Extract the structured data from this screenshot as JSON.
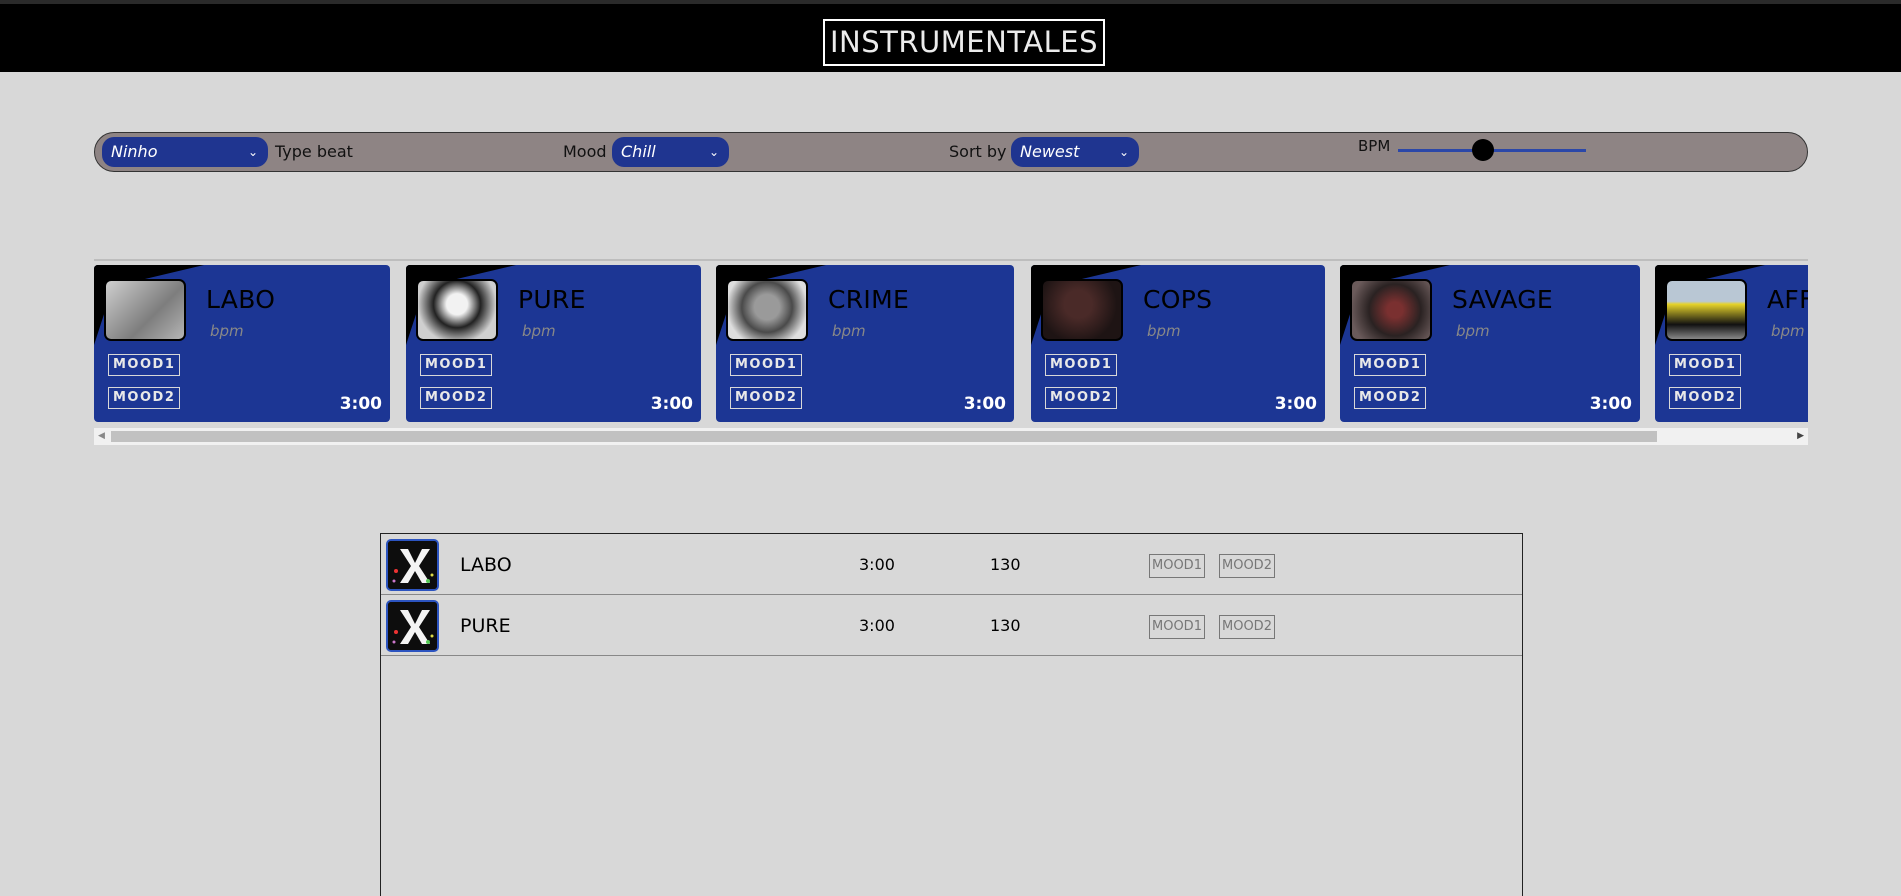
{
  "header": {
    "title": "INSTRUMENTALES"
  },
  "filters": {
    "artist": "Ninho",
    "type_beat_label": "Type beat",
    "mood_label": "Mood",
    "mood_value": "Chill",
    "sort_label": "Sort by",
    "sort_value": "Newest",
    "bpm_label": "BPM",
    "bpm_slider_fraction": 0.45
  },
  "cards": [
    {
      "name": "LABO",
      "bpm": "bpm",
      "mood1": "MOOD1",
      "mood2": "MOOD2",
      "duration": "3:00"
    },
    {
      "name": "PURE",
      "bpm": "bpm",
      "mood1": "MOOD1",
      "mood2": "MOOD2",
      "duration": "3:00"
    },
    {
      "name": "CRIME",
      "bpm": "bpm",
      "mood1": "MOOD1",
      "mood2": "MOOD2",
      "duration": "3:00"
    },
    {
      "name": "COPS",
      "bpm": "bpm",
      "mood1": "MOOD1",
      "mood2": "MOOD2",
      "duration": "3:00"
    },
    {
      "name": "SAVAGE",
      "bpm": "bpm",
      "mood1": "MOOD1",
      "mood2": "MOOD2",
      "duration": "3:00"
    },
    {
      "name": "AFF",
      "bpm": "bpm",
      "mood1": "MOOD1",
      "mood2": "MOOD2",
      "duration": ""
    }
  ],
  "tracks": [
    {
      "name": "LABO",
      "duration": "3:00",
      "bpm": "130",
      "mood1": "MOOD1",
      "mood2": "MOOD2"
    },
    {
      "name": "PURE",
      "duration": "3:00",
      "bpm": "130",
      "mood1": "MOOD1",
      "mood2": "MOOD2"
    }
  ],
  "colors": {
    "accent": "#1c3694",
    "header_bg": "#000000",
    "page_bg": "#d8d8d8",
    "filter_bar": "#8e8484"
  },
  "icons": {
    "dropdown": "chevron-down-icon",
    "track": "logo-icon"
  }
}
